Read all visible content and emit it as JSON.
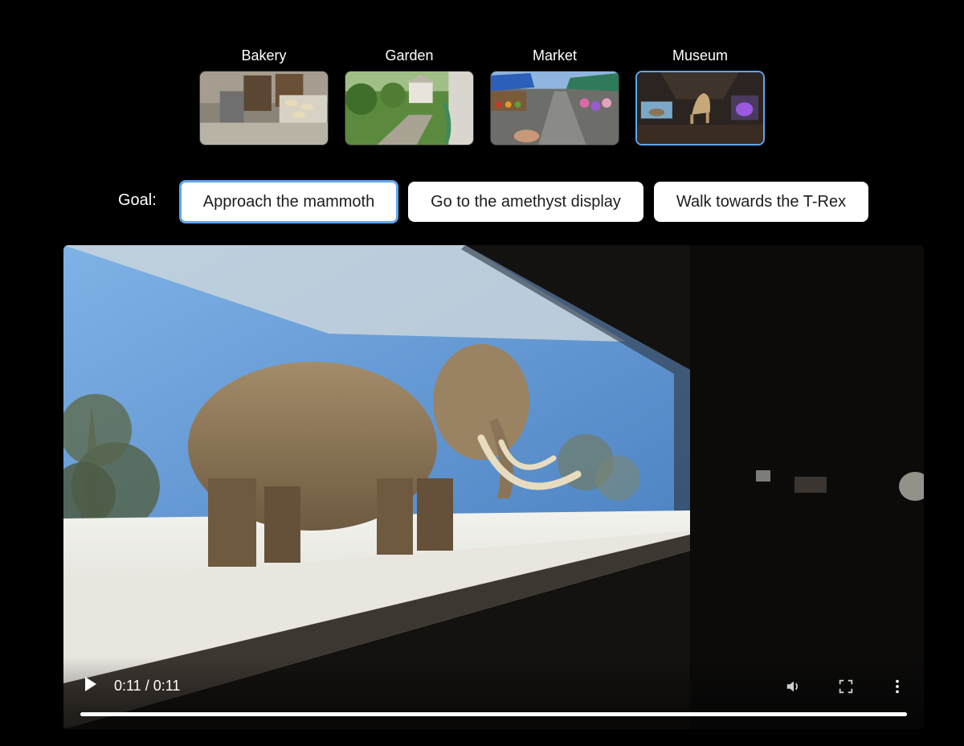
{
  "scenes": [
    {
      "label": "Bakery",
      "selected": false
    },
    {
      "label": "Garden",
      "selected": false
    },
    {
      "label": "Market",
      "selected": false
    },
    {
      "label": "Museum",
      "selected": true
    }
  ],
  "goal": {
    "label": "Goal:",
    "options": [
      {
        "label": "Approach the mammoth",
        "selected": true
      },
      {
        "label": "Go to the amethyst display",
        "selected": false
      },
      {
        "label": "Walk towards the T-Rex",
        "selected": false
      }
    ]
  },
  "video": {
    "time_display": "0:11 / 0:11",
    "progress": 1.0,
    "icons": [
      "play-icon",
      "volume-icon",
      "fullscreen-icon",
      "more-vert-icon"
    ]
  },
  "colors": {
    "background": "#000000",
    "accent": "#5ea6ec",
    "button_bg": "#ffffff"
  }
}
